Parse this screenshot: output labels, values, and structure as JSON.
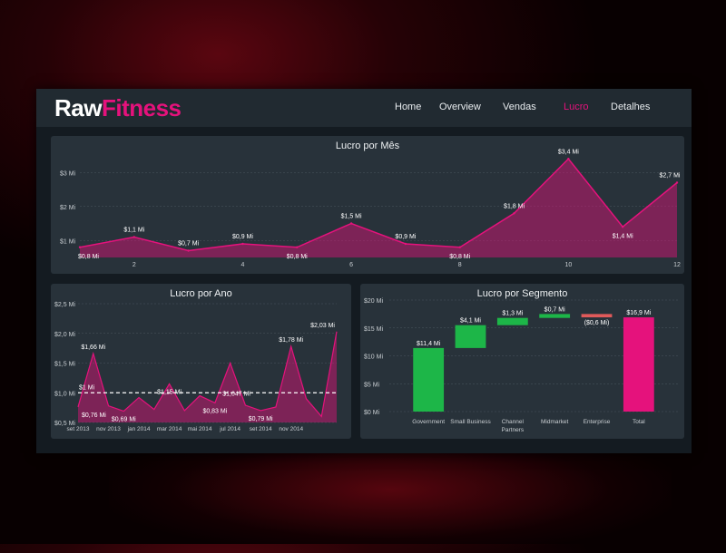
{
  "brand": {
    "name_part1": "Raw",
    "name_part2": "Fitness"
  },
  "nav": [
    {
      "label": "Home",
      "active": false
    },
    {
      "label": "Overview",
      "active": false
    },
    {
      "label": "Vendas",
      "active": false
    },
    {
      "label": "Lucro",
      "active": true
    },
    {
      "label": "Detalhes",
      "active": false
    }
  ],
  "colors": {
    "accent": "#e5127c",
    "positive": "#1db648",
    "negative": "#e05a5a",
    "total": "#e5127c"
  },
  "chart_data": [
    {
      "type": "area",
      "title": "Lucro por Mês",
      "x": [
        1,
        2,
        3,
        4,
        5,
        6,
        7,
        8,
        9,
        10,
        11,
        12
      ],
      "values": [
        0.8,
        1.1,
        0.7,
        0.9,
        0.8,
        1.5,
        0.9,
        0.8,
        1.8,
        3.4,
        1.4,
        2.7
      ],
      "point_labels": [
        "$0,8 Mi",
        "$1,1 Mi",
        "$0,7 Mi",
        "$0,9 Mi",
        "$0,8 Mi",
        "$1,5 Mi",
        "$0,9 Mi",
        "$0,8 Mi",
        "$1,8 Mi",
        "$3,4 Mi",
        "$1,4 Mi",
        "$2,7 Mi"
      ],
      "x_ticks": [
        "2",
        "4",
        "6",
        "8",
        "10",
        "12"
      ],
      "x_tick_values": [
        2,
        4,
        6,
        8,
        10,
        12
      ],
      "y_ticks": [
        "$1 Mi",
        "$2 Mi",
        "$3 Mi"
      ],
      "y_tick_values": [
        1,
        2,
        3
      ],
      "ylim": [
        0.5,
        3.7
      ],
      "grid": true
    },
    {
      "type": "area",
      "title": "Lucro por Ano",
      "values": [
        0.76,
        1.66,
        0.78,
        0.69,
        0.92,
        0.72,
        1.15,
        0.7,
        0.95,
        0.83,
        1.5,
        0.79,
        0.7,
        0.76,
        1.78,
        0.9,
        0.6,
        2.03
      ],
      "point_labels": [
        {
          "index": 0,
          "text": "$0,76 Mi"
        },
        {
          "index": 1,
          "text": "$1,66 Mi"
        },
        {
          "index": 3,
          "text": "$0,69 Mi"
        },
        {
          "index": 6,
          "text": "$1,15 Mi"
        },
        {
          "index": 9,
          "text": "$0,83 Mi"
        },
        {
          "index": 12,
          "text": "$0,79 Mi"
        },
        {
          "index": 14,
          "text": "$1,78 Mi"
        },
        {
          "index": 17,
          "text": "$2,03 Mi"
        }
      ],
      "x_ticks": [
        "set 2013",
        "nov 2013",
        "jan 2014",
        "mar 2014",
        "mai 2014",
        "jul 2014",
        "set 2014",
        "nov 2014"
      ],
      "x_tick_index": [
        0,
        2,
        4,
        6,
        8,
        10,
        12,
        14
      ],
      "y_ticks": [
        "$0,5 Mi",
        "$1,0 Mi",
        "$1,5 Mi",
        "$2,0 Mi",
        "$2,5 Mi"
      ],
      "y_tick_values": [
        0.5,
        1.0,
        1.5,
        2.0,
        2.5
      ],
      "ylim": [
        0.5,
        2.5
      ],
      "reference_line": {
        "value": 1.0,
        "label_left": "$1 Mi",
        "label_right": "$1,047 Mi"
      },
      "grid": true
    },
    {
      "type": "waterfall",
      "title": "Lucro por Segmento",
      "categories": [
        "Government",
        "Small Business",
        "Channel Partners",
        "Midmarket",
        "Enterprise",
        "Total"
      ],
      "category_lines": [
        [
          "Government"
        ],
        [
          "Small Business"
        ],
        [
          "Channel",
          "Partners"
        ],
        [
          "Midmarket"
        ],
        [
          "Enterprise"
        ],
        [
          "Total"
        ]
      ],
      "values": [
        11.4,
        4.1,
        1.3,
        0.7,
        -0.6,
        16.9
      ],
      "value_labels": [
        "$11,4 Mi",
        "$4,1 Mi",
        "$1,3 Mi",
        "$0,7 Mi",
        "($0,6 Mi)",
        "$16,9 Mi"
      ],
      "y_ticks": [
        "$0 Mi",
        "$5 Mi",
        "$10 Mi",
        "$15 Mi",
        "$20 Mi"
      ],
      "y_tick_values": [
        0,
        5,
        10,
        15,
        20
      ],
      "ylim": [
        0,
        20
      ],
      "grid": true
    }
  ]
}
